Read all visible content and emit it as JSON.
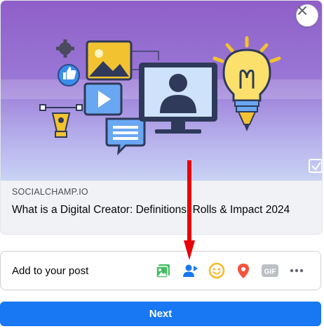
{
  "link_preview": {
    "domain": "SOCIALCHAMP.IO",
    "title": "What is a Digital Creator: Definitions, Rolls & Impact 2024"
  },
  "add_to_post": {
    "label": "Add to your post",
    "tools": [
      {
        "name": "photo-video",
        "icon": "photo-icon",
        "color": "#45bd62"
      },
      {
        "name": "tag-people",
        "icon": "tag-people-icon",
        "color": "#1877f2"
      },
      {
        "name": "feeling-activity",
        "icon": "smiley-icon",
        "color": "#f7b928"
      },
      {
        "name": "check-in",
        "icon": "location-pin-icon",
        "color": "#f5533d"
      },
      {
        "name": "gif",
        "icon": "gif-icon",
        "label": "GIF",
        "color": "#bcc0c4"
      },
      {
        "name": "more",
        "icon": "more-icon",
        "color": "#65676b"
      }
    ]
  },
  "next_button": {
    "label": "Next"
  },
  "colors": {
    "accent": "#1877f2",
    "annotation_arrow": "#e8000b"
  }
}
